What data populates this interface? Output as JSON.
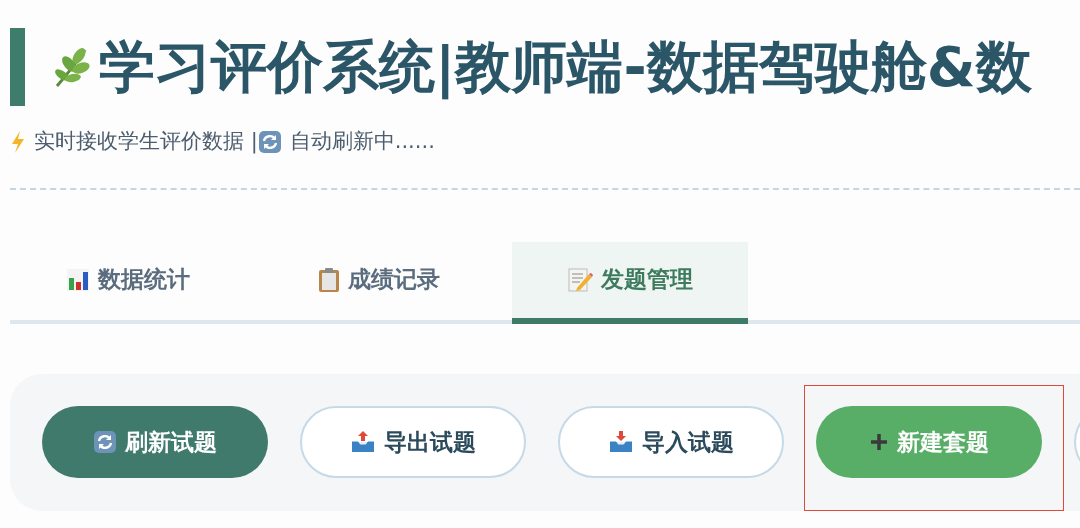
{
  "header": {
    "title": "学习评价系统|教师端-数据驾驶舱&数",
    "subtitle_parts": [
      "实时接收学生评价数据 |",
      "自动刷新中......"
    ]
  },
  "tabs": [
    {
      "label": "数据统计",
      "selected": false
    },
    {
      "label": "成绩记录",
      "selected": false
    },
    {
      "label": "发题管理",
      "selected": true
    }
  ],
  "toolbar": {
    "buttons": [
      {
        "label": "刷新试题",
        "kind": "primary",
        "highlighted": false
      },
      {
        "label": "导出试题",
        "kind": "outline",
        "highlighted": false
      },
      {
        "label": "导入试题",
        "kind": "outline",
        "highlighted": false
      },
      {
        "label": "新建套题",
        "kind": "success",
        "highlighted": true
      }
    ]
  }
}
